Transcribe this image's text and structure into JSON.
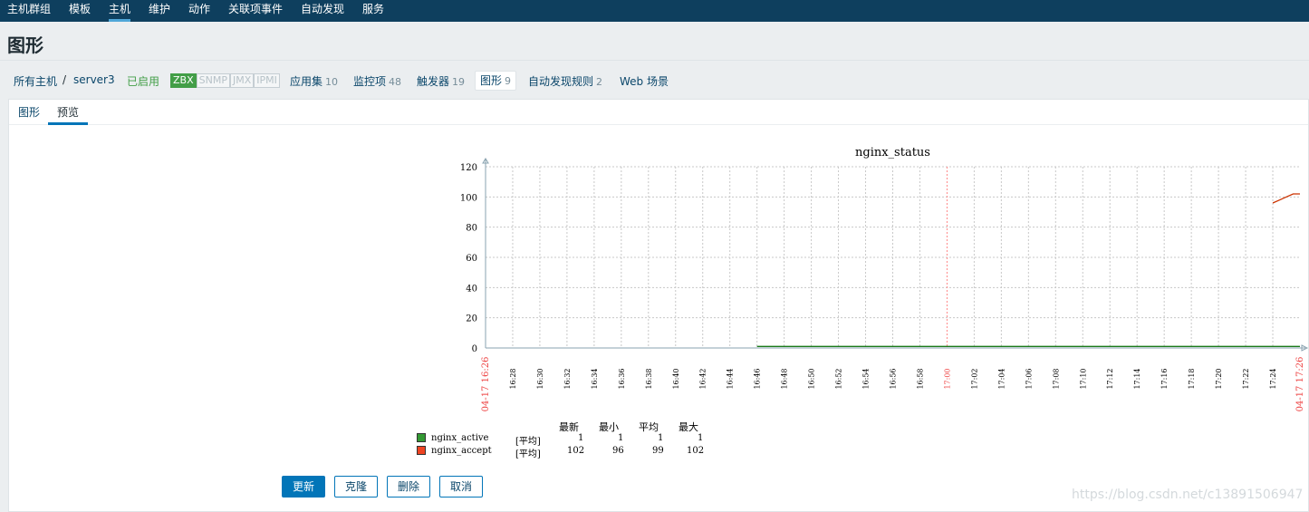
{
  "topnav": {
    "items": [
      "主机群组",
      "模板",
      "主机",
      "维护",
      "动作",
      "关联项事件",
      "自动发现",
      "服务"
    ],
    "active_index": 2
  },
  "page_title": "图形",
  "hostnav": {
    "all_hosts": "所有主机",
    "separator": "/",
    "host": "server3",
    "status": "已启用",
    "availability": [
      "ZBX",
      "SNMP",
      "JMX",
      "IPMI"
    ],
    "links": [
      {
        "label": "应用集",
        "count": "10"
      },
      {
        "label": "监控项",
        "count": "48"
      },
      {
        "label": "触发器",
        "count": "19"
      },
      {
        "label": "图形",
        "count": "9"
      },
      {
        "label": "自动发现规则",
        "count": "2"
      },
      {
        "label": "Web 场景",
        "count": ""
      }
    ],
    "active_link": "图形"
  },
  "tabs": [
    "图形",
    "预览"
  ],
  "active_tab": "预览",
  "chart_data": {
    "type": "line",
    "title": "nginx_status",
    "ylim": [
      0,
      120
    ],
    "yticks": [
      0,
      20,
      40,
      60,
      80,
      100,
      120
    ],
    "x_start_label": "04-17 16:26",
    "x_end_label": "04-17 17:26",
    "x_ticks": [
      "16:28",
      "16:30",
      "16:32",
      "16:34",
      "16:36",
      "16:38",
      "16:40",
      "16:42",
      "16:44",
      "16:46",
      "16:48",
      "16:50",
      "16:52",
      "16:54",
      "16:56",
      "16:58",
      "17:00",
      "17:02",
      "17:04",
      "17:06",
      "17:08",
      "17:10",
      "17:12",
      "17:14",
      "17:16",
      "17:18",
      "17:20",
      "17:22",
      "17:24"
    ],
    "x_red_ticks": [
      "17:00"
    ],
    "grid": true,
    "series": [
      {
        "name": "nginx_active",
        "color": "#1a7a1a",
        "x": [
          "16:46",
          "17:26"
        ],
        "y": [
          1,
          1
        ]
      },
      {
        "name": "nginx_accept",
        "color": "#cc3300",
        "x": [
          "17:24",
          "17:24.5",
          "17:25",
          "17:25.5",
          "17:26"
        ],
        "y": [
          96,
          98,
          100,
          102,
          102
        ]
      }
    ]
  },
  "legend": {
    "headers": [
      "最新",
      "最小",
      "平均",
      "最大"
    ],
    "rows": [
      {
        "name": "nginx_active",
        "func": "[平均]",
        "last": "1",
        "min": "1",
        "avg": "1",
        "max": "1",
        "color": "#339933"
      },
      {
        "name": "nginx_accept",
        "func": "[平均]",
        "last": "102",
        "min": "96",
        "avg": "99",
        "max": "102",
        "color": "#ee4422"
      }
    ]
  },
  "buttons": {
    "update": "更新",
    "clone": "克隆",
    "delete": "删除",
    "cancel": "取消"
  },
  "watermark": "https://blog.csdn.net/c13891506947"
}
